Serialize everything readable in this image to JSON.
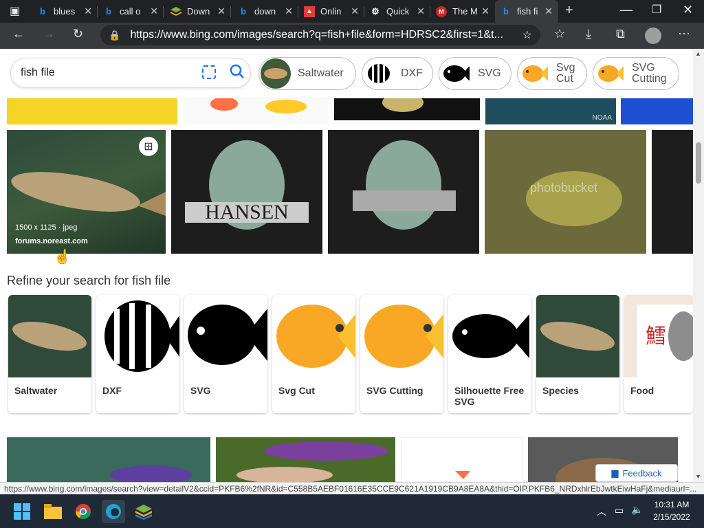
{
  "browser": {
    "tabs": [
      {
        "title": "blues",
        "icon": "bing-icon"
      },
      {
        "title": "call o",
        "icon": "bing-icon"
      },
      {
        "title": "Down",
        "icon": "stack-icon"
      },
      {
        "title": "down",
        "icon": "bing-icon"
      },
      {
        "title": "Onlin",
        "icon": "tree-icon"
      },
      {
        "title": "Quick",
        "icon": "gear-icon"
      },
      {
        "title": "The M",
        "icon": "mcafee-icon"
      },
      {
        "title": "fish fi",
        "icon": "bing-icon"
      }
    ],
    "url": "https://www.bing.com/images/search?q=fish+file&form=HDRSC2&first=1&t..."
  },
  "search": {
    "query": "fish file",
    "chips": [
      {
        "label": "Saltwater"
      },
      {
        "label": "DXF"
      },
      {
        "label": "SVG"
      },
      {
        "label": "Svg\nCut"
      },
      {
        "label": "SVG\nCutting"
      }
    ]
  },
  "results": {
    "hover_info": {
      "dims": "1500 x 1125 · jpeg",
      "source": "forums.noreast.com"
    },
    "hansen_text": "HANSEN",
    "watermark": "photobucket",
    "noaa": "NOAA"
  },
  "refine": {
    "title": "Refine your search for fish file",
    "cards": [
      {
        "label": "Saltwater"
      },
      {
        "label": "DXF"
      },
      {
        "label": "SVG"
      },
      {
        "label": "Svg Cut"
      },
      {
        "label": "SVG Cutting"
      },
      {
        "label": "Silhouette Free SVG"
      },
      {
        "label": "Species"
      },
      {
        "label": "Food"
      }
    ]
  },
  "feedback_label": "Feedback",
  "status_url": "https://www.bing.com/images/search?view=detailV2&ccid=PKFB6%2fNR&id=C558B5AEBF01616E35CCE9C621A1919CB9A8EA8A&thid=OIP.PKFB6_NRDxhlrEbJwtkEiwHaFj&mediaurl=...",
  "clock": {
    "time": "10:31 AM",
    "date": "2/15/2022"
  },
  "colors": {
    "accent": "#1a73e8",
    "taskbar": "#1f2a36",
    "tabbar": "#202124"
  }
}
